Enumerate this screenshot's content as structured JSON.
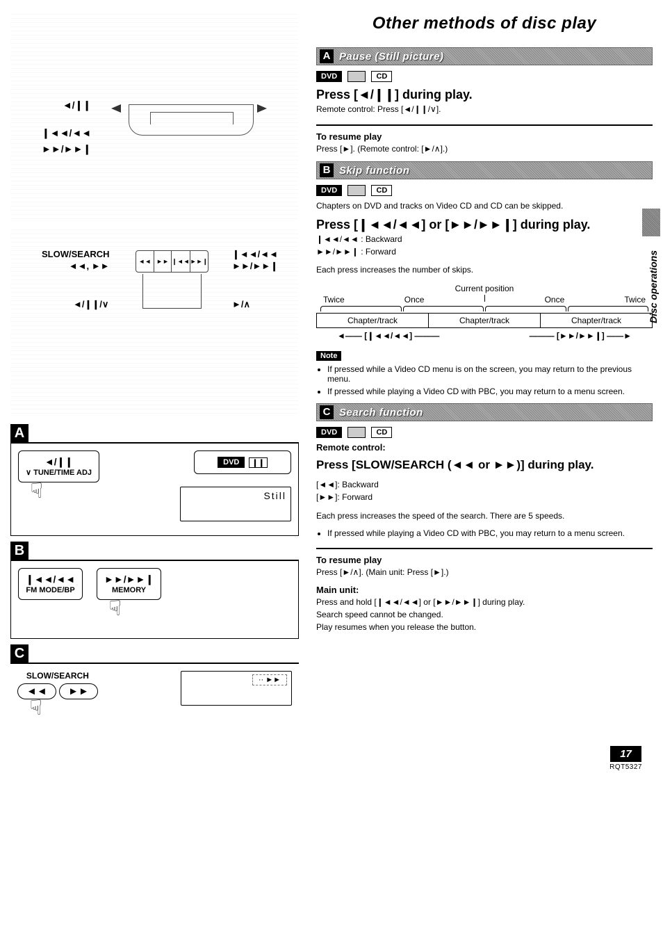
{
  "page": {
    "title": "Other methods of disc play",
    "side_tab": "Disc operations",
    "page_number": "17",
    "doc_code": "RQT5327"
  },
  "left": {
    "top_labels": {
      "pause": "◄/❙❙",
      "skip_back": "❙◄◄/◄◄",
      "skip_fwd": "►►/►►❙"
    },
    "mid_labels": {
      "slow_search": "SLOW/SEARCH",
      "slow_arrows": "◄◄, ►►",
      "skip_back": "❙◄◄/◄◄",
      "skip_fwd": "►►/►►❙",
      "pause": "◄/❙❙/∨",
      "play": "►/∧"
    },
    "panelA": {
      "letter": "A",
      "btn_sym": "◄/❙❙",
      "btn_label": "∨ TUNE/TIME ADJ",
      "display_chip": "DVD",
      "display_icon": "❙❙",
      "screen_caption": "Still"
    },
    "panelB": {
      "letter": "B",
      "btn1_sym": "❙◄◄/◄◄",
      "btn1_label": "FM MODE/BP",
      "btn2_sym": "►►/►►❙",
      "btn2_label": "MEMORY"
    },
    "panelC": {
      "letter": "C",
      "label": "SLOW/SEARCH",
      "btn_back": "◄◄",
      "btn_fwd": "►►",
      "screen_icon": "·· ►►"
    }
  },
  "sectionA": {
    "letter": "A",
    "title": "Pause (Still picture)",
    "chip_dvd": "DVD",
    "chip_cd": "CD",
    "instruction": "Press [◄/❙❙] during play.",
    "sub": "Remote control: Press [◄/❙❙/∨].",
    "resume_head": "To resume play",
    "resume_body": "Press [►]. (Remote control: [►/∧].)"
  },
  "sectionB": {
    "letter": "B",
    "title": "Skip function",
    "chip_dvd": "DVD",
    "chip_cd": "CD",
    "intro": "Chapters on DVD and tracks on Video CD and CD can be skipped.",
    "instruction": "Press [❙◄◄/◄◄] or [►►/►►❙] during play.",
    "dir_back": "❙◄◄/◄◄ : Backward",
    "dir_fwd": "►►/►►❙ : Forward",
    "each": "Each press increases the number of skips.",
    "diagram": {
      "current": "Current position",
      "twice_l": "Twice",
      "once_l": "Once",
      "once_r": "Once",
      "twice_r": "Twice",
      "cell": "Chapter/track",
      "arrow_back": "◄—— [❙◄◄/◄◄] ———",
      "arrow_fwd": "——— [►►/►►❙] ——►"
    },
    "note_label": "Note",
    "note1": "If pressed while a Video CD menu is on the screen, you may return to the previous menu.",
    "note2": "If pressed while playing a Video CD with PBC, you may return to a menu screen."
  },
  "sectionC": {
    "letter": "C",
    "title": "Search function",
    "chip_dvd": "DVD",
    "chip_cd": "CD",
    "remote_head": "Remote control:",
    "instruction": "Press [SLOW/SEARCH (◄◄ or ►►)] during play.",
    "dir_back": "[◄◄]: Backward",
    "dir_fwd": "[►►]: Forward",
    "each": "Each press increases the speed of the search. There are 5 speeds.",
    "note1": "If pressed while playing a Video CD with PBC, you may return to a menu screen.",
    "resume_head": "To resume play",
    "resume_body": "Press [►/∧]. (Main unit: Press [►].)",
    "main_head": "Main unit:",
    "main1": "Press and hold [❙◄◄/◄◄] or [►►/►►❙] during play.",
    "main2": "Search speed cannot be changed.",
    "main3": "Play resumes when you release the button."
  }
}
